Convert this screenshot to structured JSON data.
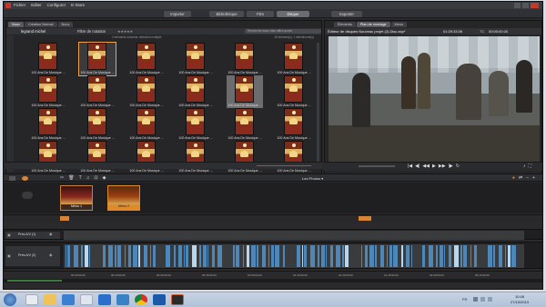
{
  "app": {
    "menus": [
      "Fichier",
      "Editer",
      "Configurer",
      "E-Store"
    ],
    "top_buttons": [
      "Importer",
      "Bibliothèque",
      "Film",
      "Disque",
      "Exporter"
    ],
    "active_top": "Disque"
  },
  "library": {
    "tabs": [
      "Nouv",
      "Création Normal",
      "Nouv"
    ],
    "folder": "legrand michel",
    "filter_label": "Filtre de notation",
    "search_placeholder": "Recherche dans votre affich actuel",
    "info_line": "2 éléments suivants; sélection multiple",
    "count_line": "15 élément(s), 1 sélectionné(s)",
    "thumb_label": "100 Ans De Musique ...",
    "rows": 4,
    "cols": 6,
    "selected_index": 1,
    "gray_index": 10
  },
  "editor": {
    "tabs": [
      "Éléments",
      "Plan de montage",
      "Menu"
    ],
    "title": "Éditeur de disques Nouveau projet (2).Disc.axp*",
    "timecode": "01:29:33.06",
    "tc_label": "TC",
    "tc_value": "00:00:00.00",
    "ruler": [
      "00:00:00.00",
      "00:00:30.00",
      "01:00:00.00",
      "01:30:00.00",
      "02:00:00.00"
    ]
  },
  "menus_strip": {
    "items": [
      "Menu 1",
      "Menu 2"
    ],
    "dropdown": "Les Photos"
  },
  "timeline": {
    "tracks": [
      {
        "name": "Prés A/V (1)"
      },
      {
        "name": "Prés A/V (2)"
      }
    ],
    "ruler": [
      "00:00:00.00",
      "00:15:00.00",
      "00:30:00.00",
      "00:45:00.00",
      "01:00:00.00",
      "01:15:00.00",
      "01:30:00.00",
      "01:45:00.00",
      "02:00:00.00",
      "02:15:00.00"
    ]
  },
  "taskbar": {
    "lang": "FR",
    "time": "10:48",
    "date": "27/10/2013"
  }
}
